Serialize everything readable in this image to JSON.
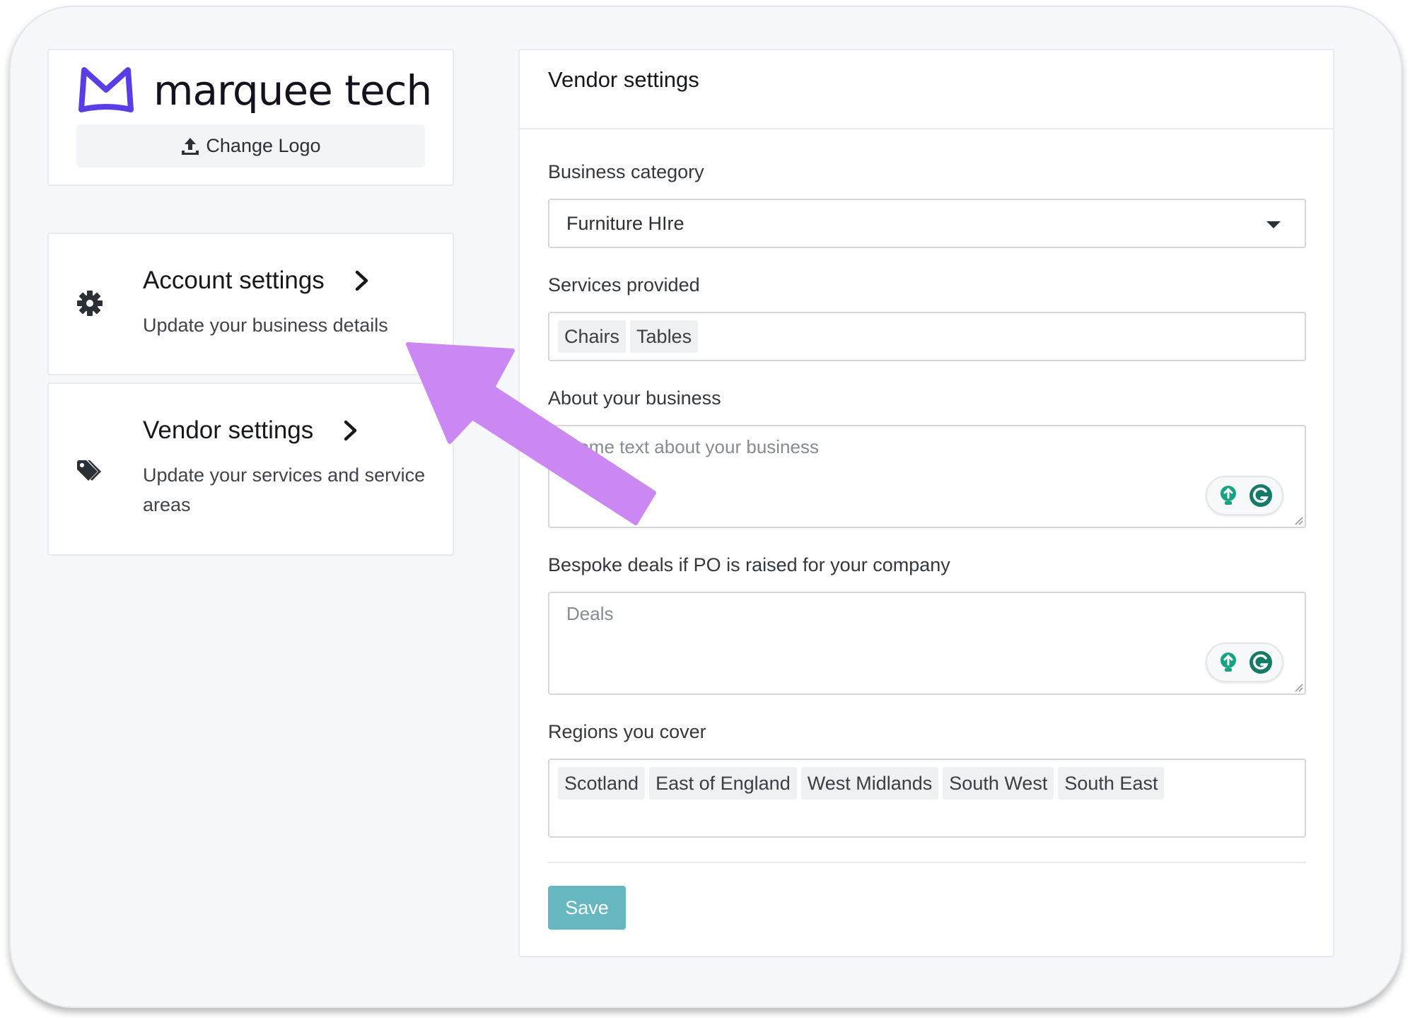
{
  "brand": {
    "name": "marquee tech",
    "change_logo_label": "Change Logo",
    "logo_color": "#5b3de6"
  },
  "nav": {
    "account": {
      "title": "Account settings",
      "subtitle": "Update your business details",
      "icon": "gear-icon"
    },
    "vendor": {
      "title": "Vendor settings",
      "subtitle": "Update your services and service areas",
      "icon": "tags-icon"
    }
  },
  "panel": {
    "title": "Vendor settings",
    "business_category": {
      "label": "Business category",
      "value": "Furniture HIre"
    },
    "services": {
      "label": "Services provided",
      "tags": [
        "Chairs",
        "Tables"
      ]
    },
    "about": {
      "label": "About your business",
      "placeholder": "Some text about your business"
    },
    "deals": {
      "label": "Bespoke deals if PO is raised for your company",
      "placeholder": "Deals"
    },
    "regions": {
      "label": "Regions you cover",
      "tags": [
        "Scotland",
        "East of England",
        "West Midlands",
        "South West",
        "South East"
      ]
    },
    "save_label": "Save"
  },
  "colors": {
    "accent": "#67b7c1",
    "annotation_arrow": "#cc88f2",
    "grammarly_green": "#15a383"
  }
}
